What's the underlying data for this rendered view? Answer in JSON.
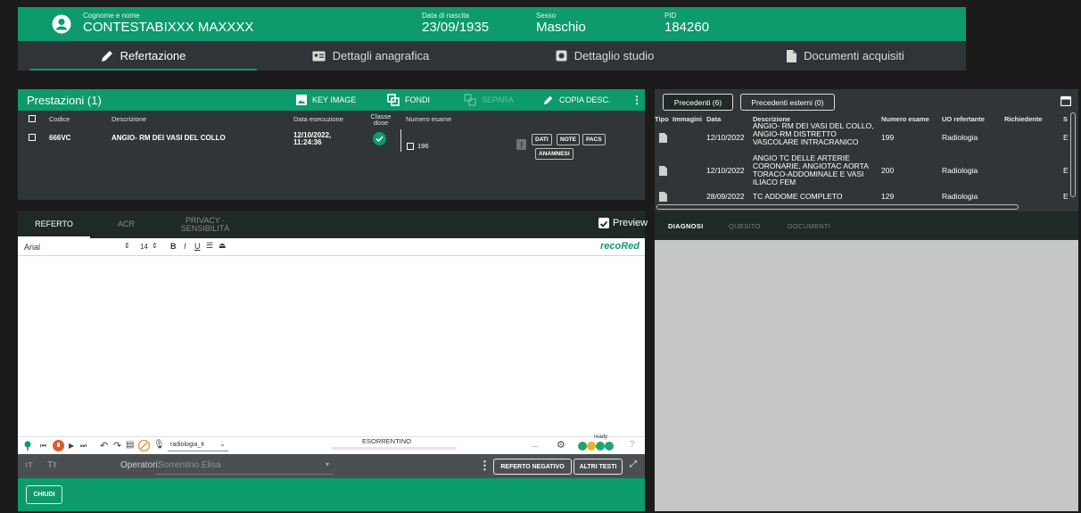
{
  "header": {
    "name_label": "Cognome e nome",
    "name_value": "CONTESTABIXXX MAXXXX",
    "dob_label": "Data di nascita",
    "dob_value": "23/09/1935",
    "sex_label": "Sesso",
    "sex_value": "Maschio",
    "pid_label": "PID",
    "pid_value": "184260"
  },
  "tabs": [
    {
      "label": "Refertazione"
    },
    {
      "label": "Dettagli anagrafica"
    },
    {
      "label": "Dettaglio studio"
    },
    {
      "label": "Documenti acquisiti"
    }
  ],
  "prestazioni": {
    "title": "Prestazioni (1)",
    "toolbar": {
      "key_image": "KEY IMAGE",
      "fondi": "FONDI",
      "separa": "SEPARA",
      "copia_desc": "COPIA DESC."
    },
    "columns": {
      "codice": "Codice",
      "descrizione": "Descrizione",
      "data": "Data esecuzione",
      "classe": "Classe dose",
      "numero": "Numero esame"
    },
    "row": {
      "codice": "666VC",
      "descrizione": "ANGIO- RM DEI VASI DEL COLLO",
      "data": "12/10/2022, 11:24:36",
      "numero": "196"
    },
    "mini_buttons": {
      "dati": "DATI",
      "note": "NOTE",
      "pacs": "PACS",
      "anamnesi": "ANAMNESI"
    }
  },
  "referto": {
    "tabs": {
      "referto": "REFERTO",
      "acr": "ACR",
      "privacy": "PRIVACY - SENSIBILITÀ"
    },
    "preview_label": "Preview",
    "font_name": "Arial",
    "font_size": "14",
    "brand": "recoRed",
    "dictation_user": "ESORRENTINO",
    "language_model": "radiologia_it",
    "status": "ready",
    "operator_label": "Operatori:",
    "operator_value": "Sorrentino Elisa",
    "btn_referto_negativo": "REFERTO NEGATIVO",
    "btn_altri_testi": "ALTRI TESTI",
    "btn_chiudi": "CHIUDI"
  },
  "precedenti": {
    "btn_precedenti": "Precedenti (6)",
    "btn_esterni": "Precedenti esterni (0)",
    "columns": {
      "tipo": "Tipo",
      "immagini": "Immagini",
      "data": "Data",
      "descrizione": "Descrizione",
      "numero": "Numero esame",
      "uo": "UO refertante",
      "richiedente": "Richiedente",
      "s": "S"
    },
    "rows": [
      {
        "data": "12/10/2022",
        "descrizione": "ANGIO- RM DEI VASI DEL COLLO, ANGIO-RM DISTRETTO VASCOLARE INTRACRANICO",
        "numero": "199",
        "uo": "Radiologia",
        "s": "E"
      },
      {
        "data": "12/10/2022",
        "descrizione": "ANGIO TC DELLE ARTERIE CORONARIE, ANGIOTAC AORTA TORACO-ADDOMINALE E VASI ILIACO FEM",
        "numero": "200",
        "uo": "Radiologia",
        "s": "E"
      },
      {
        "data": "28/09/2022",
        "descrizione": "TC ADDOME COMPLETO",
        "numero": "129",
        "uo": "Radiologia",
        "s": "E"
      }
    ],
    "tabs": {
      "diagnosi": "DIAGNOSI",
      "quesito": "QUESITO",
      "documenti": "DOCUMENTI"
    }
  },
  "colors": {
    "primary_green": "#0d9a6c",
    "panel_dark": "#303637"
  }
}
